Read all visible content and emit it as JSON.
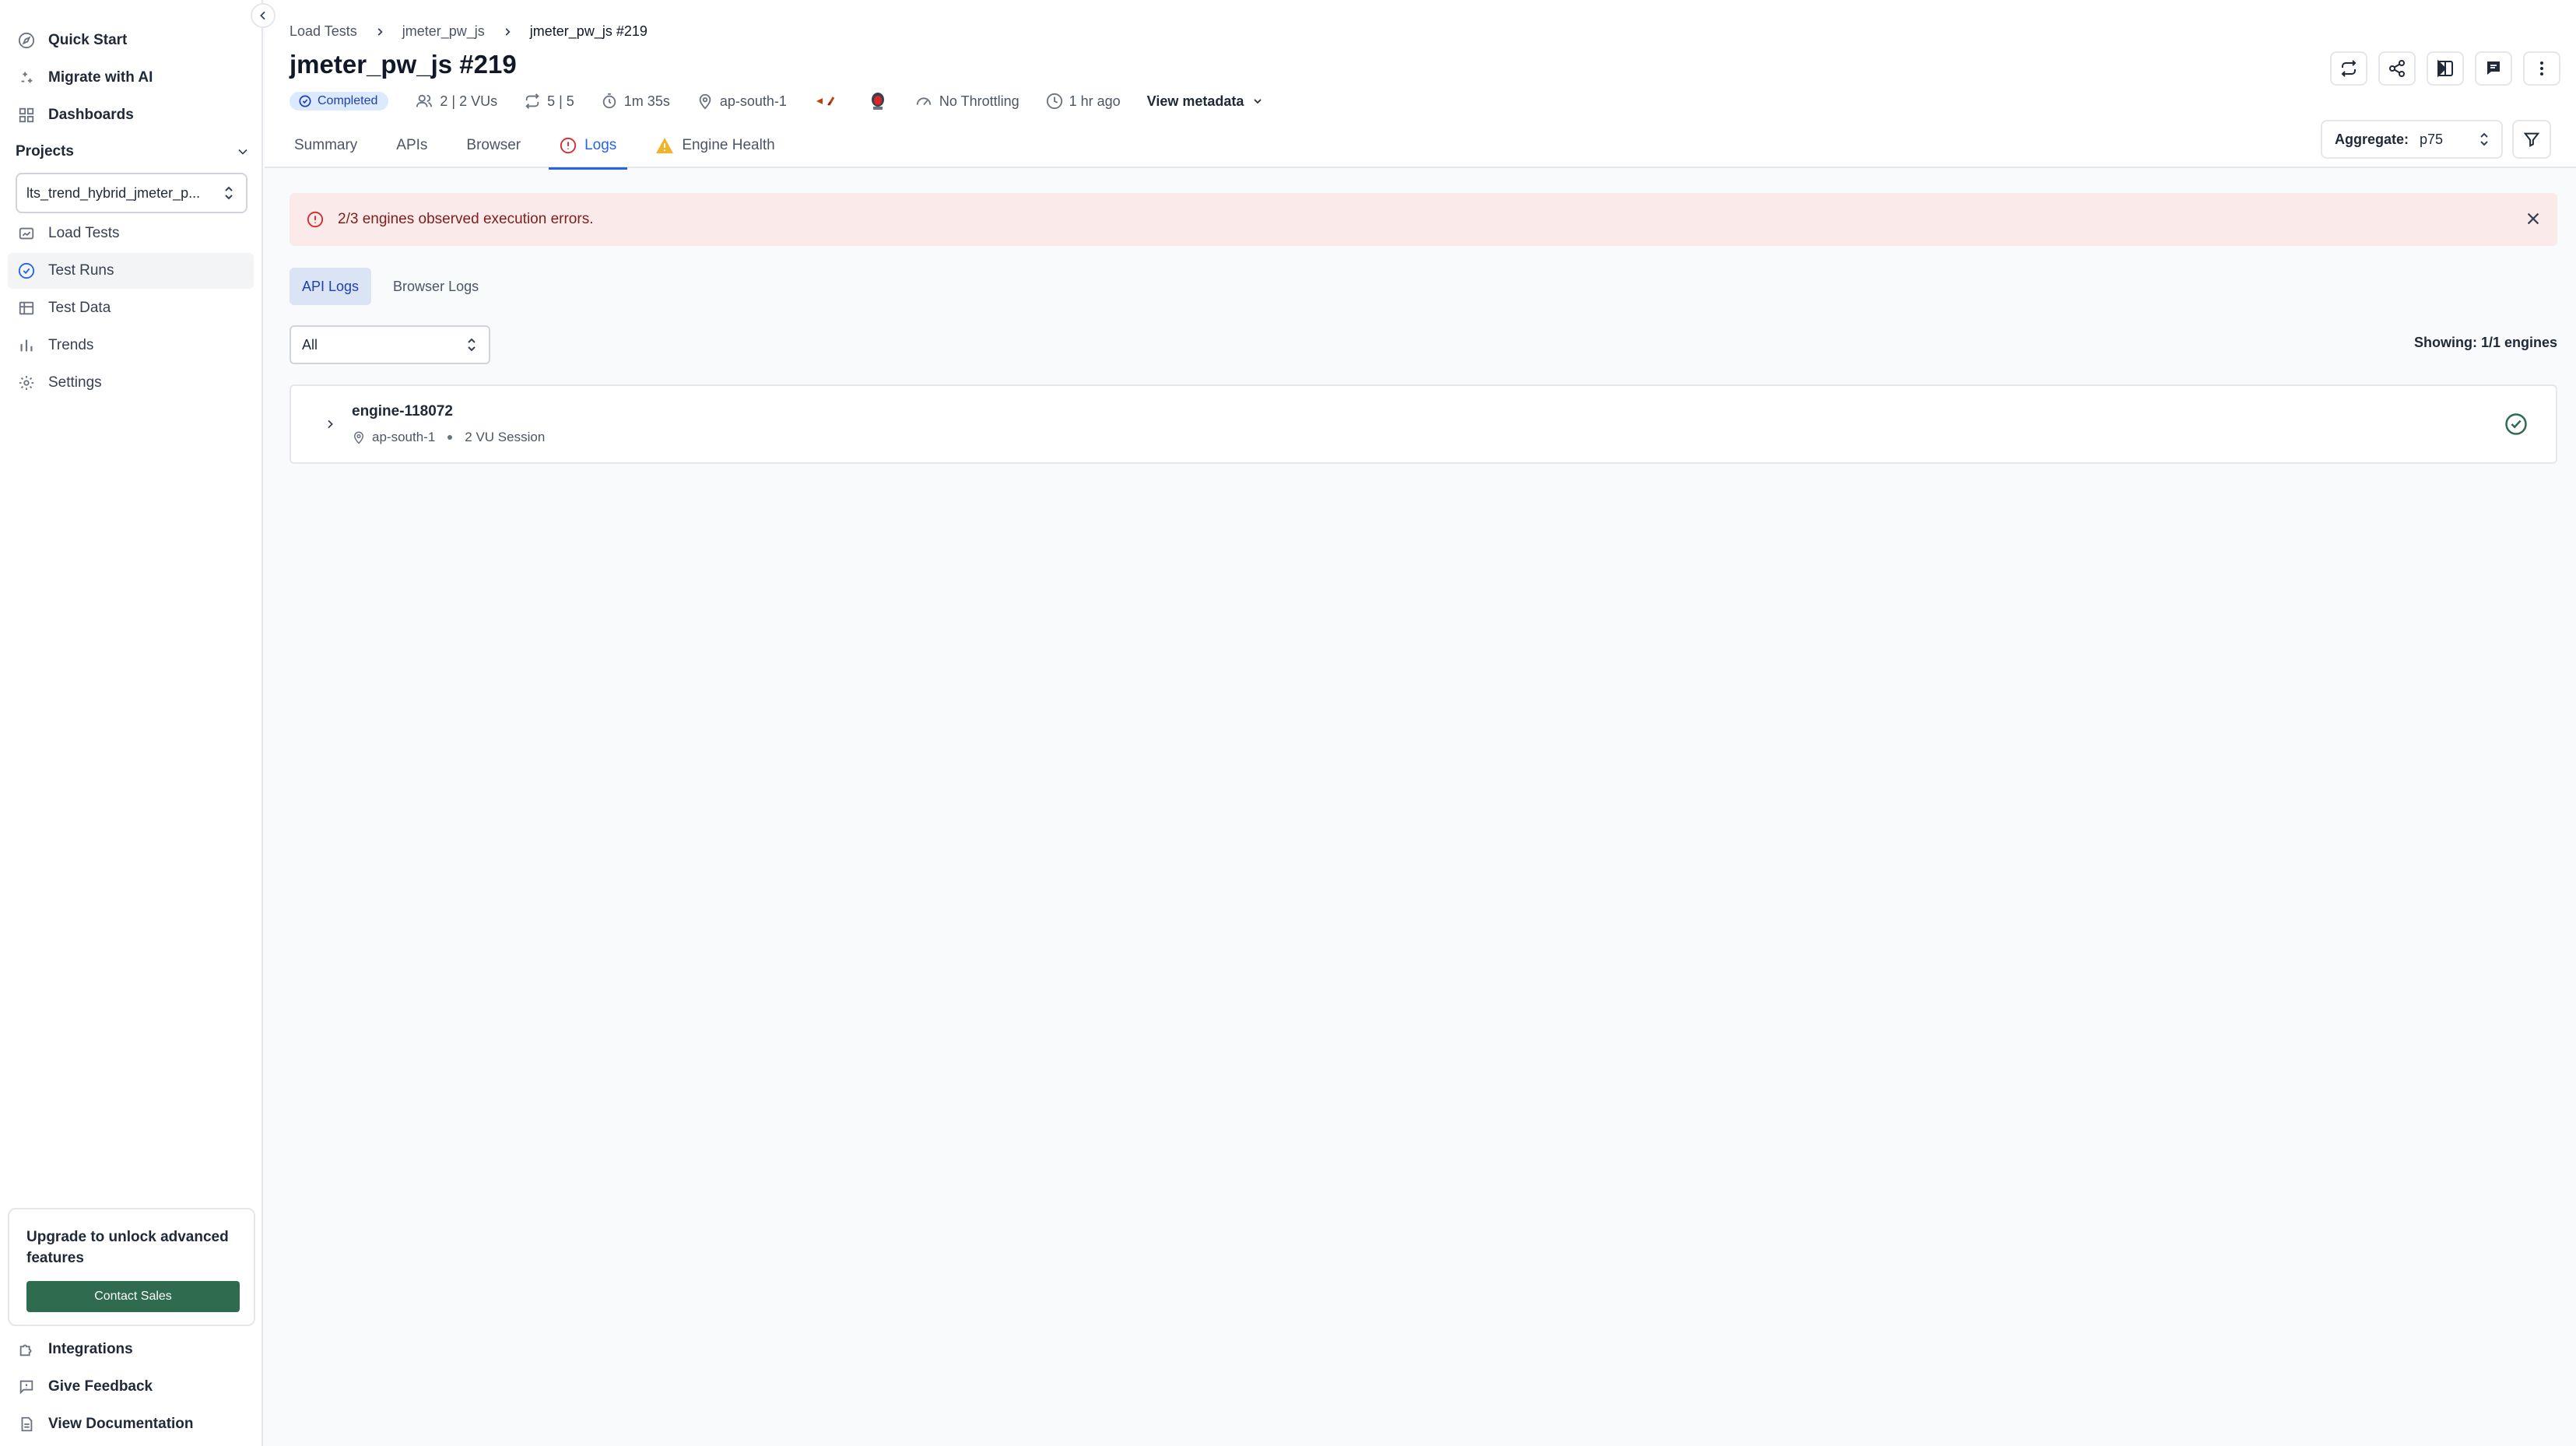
{
  "sidebar": {
    "top_items": [
      {
        "label": "Quick Start",
        "icon": "compass-icon"
      },
      {
        "label": "Migrate with AI",
        "icon": "sparkle-icon"
      },
      {
        "label": "Dashboards",
        "icon": "grid-icon"
      }
    ],
    "projects_label": "Projects",
    "project_value": "lts_trend_hybrid_jmeter_p...",
    "project_items": [
      {
        "label": "Load Tests",
        "icon": "load-tests-icon"
      },
      {
        "label": "Test Runs",
        "icon": "test-runs-icon",
        "active": true
      },
      {
        "label": "Test Data",
        "icon": "table-icon"
      },
      {
        "label": "Trends",
        "icon": "bar-chart-icon"
      },
      {
        "label": "Settings",
        "icon": "gear-icon"
      }
    ],
    "upgrade_text": "Upgrade to unlock advanced features",
    "contact_label": "Contact Sales",
    "bottom_items": [
      {
        "label": "Integrations",
        "icon": "puzzle-icon"
      },
      {
        "label": "Give Feedback",
        "icon": "feedback-icon"
      },
      {
        "label": "View Documentation",
        "icon": "doc-icon"
      }
    ]
  },
  "header": {
    "breadcrumb": [
      "Load Tests",
      "jmeter_pw_js",
      "jmeter_pw_js #219"
    ],
    "title": "jmeter_pw_js #219",
    "status": "Completed",
    "vus": "2 | 2 VUs",
    "iterations": "5 | 5",
    "duration": "1m 35s",
    "region": "ap-south-1",
    "throttling": "No Throttling",
    "time_ago": "1 hr ago",
    "view_metadata": "View metadata"
  },
  "tabs": [
    {
      "label": "Summary"
    },
    {
      "label": "APIs"
    },
    {
      "label": "Browser"
    },
    {
      "label": "Logs",
      "active": true
    },
    {
      "label": "Engine Health"
    }
  ],
  "aggregate": {
    "label": "Aggregate:",
    "value": "p75"
  },
  "alert": {
    "message": "2/3 engines observed execution errors."
  },
  "log_tabs": [
    {
      "label": "API Logs",
      "active": true
    },
    {
      "label": "Browser Logs"
    }
  ],
  "engine_filter": {
    "value": "All"
  },
  "showing": "Showing: 1/1 engines",
  "engines": [
    {
      "name": "engine-118072",
      "region": "ap-south-1",
      "session": "2 VU Session"
    }
  ],
  "colors": {
    "accent": "#2563eb",
    "brand_green": "#2f6b4f",
    "alert_bg": "#fbeaea",
    "alert_text": "#7f1d1d",
    "warning": "#f0b429",
    "error": "#dc2626"
  }
}
